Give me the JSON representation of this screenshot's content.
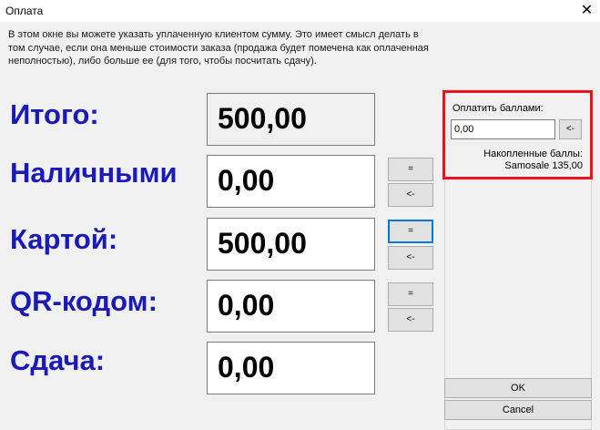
{
  "window": {
    "title": "Оплата",
    "close_glyph": "✕"
  },
  "description": "В этом окне вы можете указать уплаченную клиентом сумму. Это имеет смысл делать в том случае, если она меньше стоимости заказа (продажа будет помечена как оплаченная неполностью), либо больше  ее (для того, чтобы посчитать сдачу).",
  "rows": {
    "total": {
      "label": "Итого:",
      "value": "500,00"
    },
    "cash": {
      "label": "Наличными",
      "value": "0,00",
      "eq": "=",
      "back": "<-"
    },
    "card": {
      "label": "Картой:",
      "value": "500,00",
      "eq": "=",
      "back": "<-"
    },
    "qr": {
      "label": "QR-кодом:",
      "value": "0,00",
      "eq": "=",
      "back": "<-"
    },
    "change": {
      "label": "Сдача:",
      "value": "0,00"
    }
  },
  "points": {
    "label": "Оплатить баллами:",
    "value": "0,00",
    "back": "<-",
    "accumulated_label": "Накопленные баллы:",
    "accumulated_value": "Samosale 135,00"
  },
  "buttons": {
    "ok": "OK",
    "cancel": "Cancel"
  },
  "colors": {
    "label_blue": "#1a1ab8",
    "highlight_red": "#e8141a",
    "focus_blue": "#0078d7"
  }
}
